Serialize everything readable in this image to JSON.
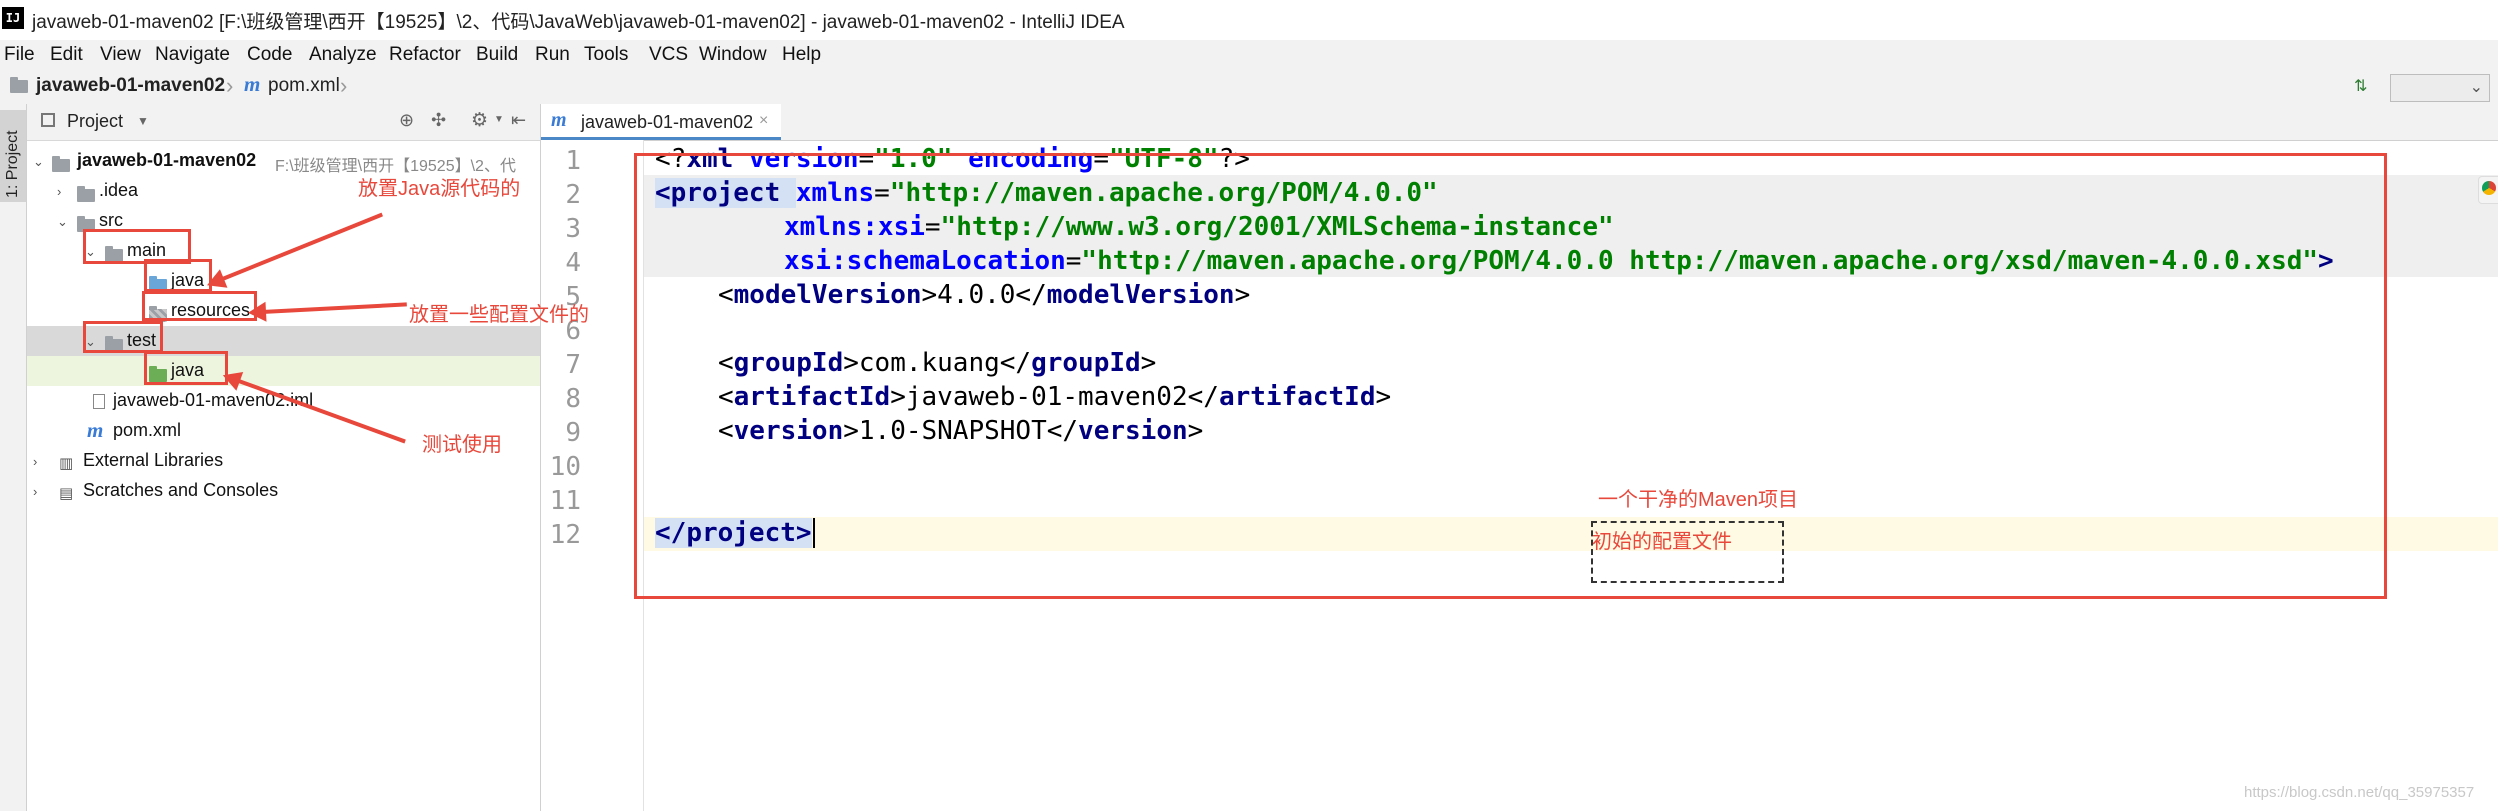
{
  "window": {
    "title": "javaweb-01-maven02 [F:\\班级管理\\西开【19525】\\2、代码\\JavaWeb\\javaweb-01-maven02] - javaweb-01-maven02 - IntelliJ IDEA"
  },
  "menu": [
    "File",
    "Edit",
    "View",
    "Navigate",
    "Code",
    "Analyze",
    "Refactor",
    "Build",
    "Run",
    "Tools",
    "VCS",
    "Window",
    "Help"
  ],
  "breadcrumb": {
    "project": "javaweb-01-maven02",
    "file": "pom.xml"
  },
  "sidebar": {
    "tab_label": "1: Project"
  },
  "project_panel": {
    "title": "Project",
    "tree": {
      "root": "javaweb-01-maven02",
      "root_path": "F:\\班级管理\\西开【19525】\\2、代",
      "idea": ".idea",
      "src": "src",
      "main": "main",
      "main_java": "java",
      "resources": "resources",
      "test": "test",
      "test_java": "java",
      "iml": "javaweb-01-maven02.iml",
      "pom": "pom.xml",
      "external": "External Libraries",
      "scratches": "Scratches and Consoles"
    }
  },
  "editor": {
    "tab_label": "javaweb-01-maven02",
    "line_numbers": [
      "1",
      "2",
      "3",
      "4",
      "5",
      "6",
      "7",
      "8",
      "9",
      "10",
      "11",
      "12"
    ],
    "lines": {
      "l1a": "<?",
      "l1b": "xml ",
      "l1c": "version",
      "l1d": "=",
      "l1e": "\"1.0\" ",
      "l1f": "encoding",
      "l1g": "=",
      "l1h": "\"UTF-8\"",
      "l1i": "?>",
      "l2a": "<project ",
      "l2b": "xmlns",
      "l2c": "=",
      "l2d": "\"http://maven.apache.org/POM/4.0.0\"",
      "l3a": "xmlns:xsi",
      "l3b": "=",
      "l3c": "\"http://www.w3.org/2001/XMLSchema-instance\"",
      "l4a": "xsi:schemaLocation",
      "l4b": "=",
      "l4c": "\"http://maven.apache.org/POM/4.0.0 http://maven.apache.org/xsd/maven-4.0.0.xsd\"",
      "l4d": ">",
      "l5a": "<",
      "l5b": "modelVersion",
      "l5c": ">4.0.0</",
      "l5d": "modelVersion",
      "l5e": ">",
      "l7a": "<",
      "l7b": "groupId",
      "l7c": ">com.kuang</",
      "l7d": "groupId",
      "l7e": ">",
      "l8a": "<",
      "l8b": "artifactId",
      "l8c": ">javaweb-01-maven02</",
      "l8d": "artifactId",
      "l8e": ">",
      "l9a": "<",
      "l9b": "version",
      "l9c": ">1.0-SNAPSHOT</",
      "l9d": "version",
      "l9e": ">",
      "l12a": "</",
      "l12b": "project",
      "l12c": ">"
    }
  },
  "annotations": {
    "java_src": "放置Java源代码的",
    "resources": "放置一些配置文件的",
    "test": "测试使用",
    "clean_maven": "一个干净的Maven项目",
    "initial_config": "初始的配置文件"
  },
  "watermark": "https://blog.csdn.net/qq_35975357",
  "colors": {
    "annotation_red": "#e8483b",
    "tag_blue": "#000080",
    "attr_blue": "#0000ff",
    "string_green": "#008000"
  }
}
